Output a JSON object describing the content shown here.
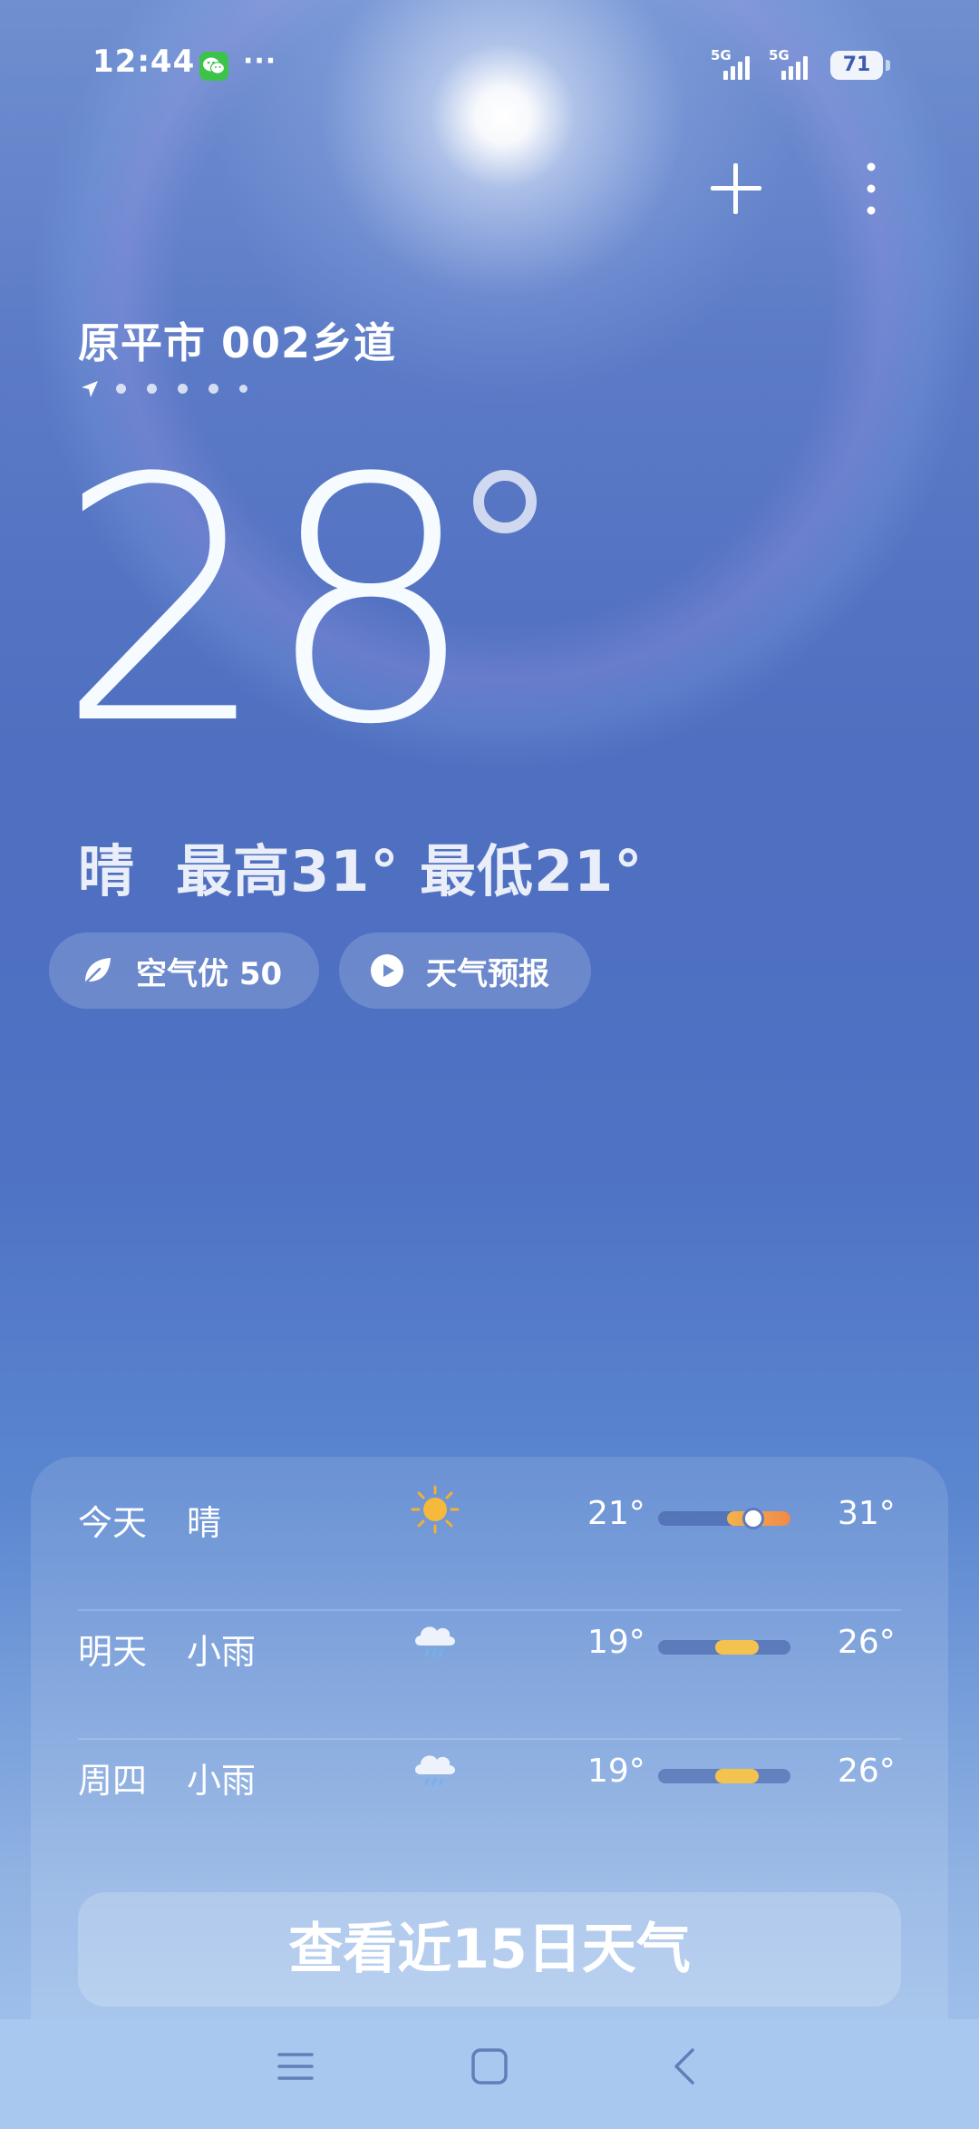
{
  "status_bar": {
    "time": "12:44",
    "more": "···",
    "signals": [
      {
        "gen": "5G"
      },
      {
        "gen": "5G"
      }
    ],
    "battery": "71",
    "icons": [
      "wechat-icon",
      "signal-icon",
      "signal-icon",
      "battery-icon"
    ]
  },
  "header": {
    "icons": [
      "plus-icon",
      "more-vertical-icon"
    ]
  },
  "location": {
    "name": "原平市 002乡道",
    "page_count": 5,
    "icon": "navigation-arrow-icon"
  },
  "current": {
    "temperature": "28",
    "condition_line": "晴  最高31° 最低21°"
  },
  "pills": {
    "aqi": {
      "label": "空气优 50",
      "icon": "leaf-icon"
    },
    "forecast": {
      "label": "天气预报",
      "icon": "play-icon"
    }
  },
  "forecast": {
    "days": [
      {
        "day": "今天",
        "condition": "晴",
        "icon": "sun-icon",
        "low": "21°",
        "high": "31°",
        "range_start": 0.52,
        "range_end": 1.0,
        "current_position": 0.72
      },
      {
        "day": "明天",
        "condition": "小雨",
        "icon": "rain-cloud-icon",
        "low": "19°",
        "high": "26°",
        "range_start": 0.43,
        "range_end": 0.76
      },
      {
        "day": "周四",
        "condition": "小雨",
        "icon": "rain-cloud-icon",
        "low": "19°",
        "high": "26°",
        "range_start": 0.43,
        "range_end": 0.76
      }
    ],
    "bar_colors": {
      "warm": "#f4b24a",
      "hot": "#f08a4a",
      "mild": "#f3c24f"
    },
    "view15_label": "查看近15日天气"
  },
  "nav_bar": {
    "icons": [
      "menu-icon",
      "home-icon",
      "back-icon"
    ]
  }
}
